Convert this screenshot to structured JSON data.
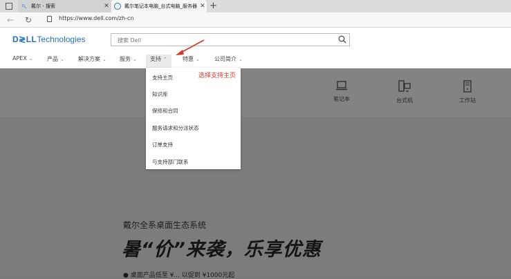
{
  "browser": {
    "tabs": [
      {
        "title": "戴尔 - 搜索",
        "close": "✕"
      },
      {
        "title": "戴尔笔记本电脑_台式电脑_服务器",
        "close": "✕"
      }
    ],
    "new_tab": "+",
    "url": "https://www.dell.com/zh-cn"
  },
  "header": {
    "logo_bold": "D≷LL",
    "logo_rest": "Technologies",
    "search_placeholder": "搜索 Dell"
  },
  "menu": [
    {
      "label": "APEX"
    },
    {
      "label": "产品"
    },
    {
      "label": "解决方案"
    },
    {
      "label": "服务"
    },
    {
      "label": "支持"
    },
    {
      "label": "特惠"
    },
    {
      "label": "公司简介"
    }
  ],
  "dropdown": [
    "支持主页",
    "知识库",
    "保修和合同",
    "服务请求和分派状态",
    "订单支持",
    "与支持部门联系"
  ],
  "annotation": "选择支持主页",
  "categories": [
    {
      "label": "笔记本",
      "icon": "laptop-icon"
    },
    {
      "label": "台式机",
      "icon": "desktop-icon"
    },
    {
      "label": "工作站",
      "icon": "workstation-icon"
    }
  ],
  "hero": {
    "subtitle": "戴尔全系桌面生态系统",
    "title": "暑“价”来袭，乐享优惠",
    "cutoff": "● 桌面产品低至 ¥... 以促到 ¥1000元起"
  },
  "colors": {
    "accent": "#1f6fc2",
    "annotation": "#d03a2a"
  }
}
